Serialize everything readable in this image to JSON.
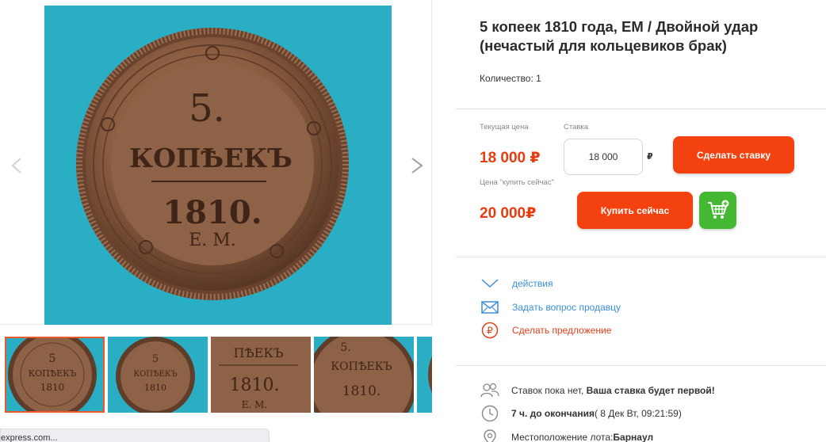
{
  "lot": {
    "title": "5 копеек 1810 года, ЕМ / Двойной удар (нечастый для кольцевиков брак)",
    "quantity": "Количество: 1"
  },
  "coin": {
    "denomination_top": "5.",
    "denomination_word": "КОПѢЕКЪ",
    "year": "1810.",
    "mint": "Е. М."
  },
  "pricing": {
    "current_label": "Текущая цена",
    "current_price": "18 000 ₽",
    "bid_label": "Ставка",
    "bid_value": "18 000",
    "bid_currency": "₽",
    "bid_button": "Сделать ставку",
    "buy_now_label": "Цена \"купить сейчас\"",
    "buy_now_price": "20 000₽",
    "buy_now_button": "Купить сейчас"
  },
  "actions": {
    "menu": "действия",
    "ask_seller": "Задать вопрос продавцу",
    "make_offer": "Сделать предложение"
  },
  "info": {
    "bids_prefix": "Ставок пока нет, ",
    "bids_bold": "Ваша ставка будет первой!",
    "time_left": "7 ч. до окончания",
    "end_date": " ( 8 Дек Вт, 09:21:59)",
    "location_label": "Местоположение лота: ",
    "location_value": "Барнаул"
  },
  "browser": {
    "status_url": "express.com..."
  },
  "colors": {
    "accent_orange": "#f3420f",
    "price_red": "#e63c12",
    "link_blue": "#3c8ed8",
    "cart_green": "#45b833",
    "photo_background": "#2aaec3"
  },
  "icons": [
    "expand-icon",
    "chevron-left-icon",
    "chevron-right-icon",
    "cart-add-icon",
    "chevron-down-icon",
    "envelope-icon",
    "ruble-circle-icon",
    "users-icon",
    "clock-icon",
    "location-pin-icon"
  ]
}
